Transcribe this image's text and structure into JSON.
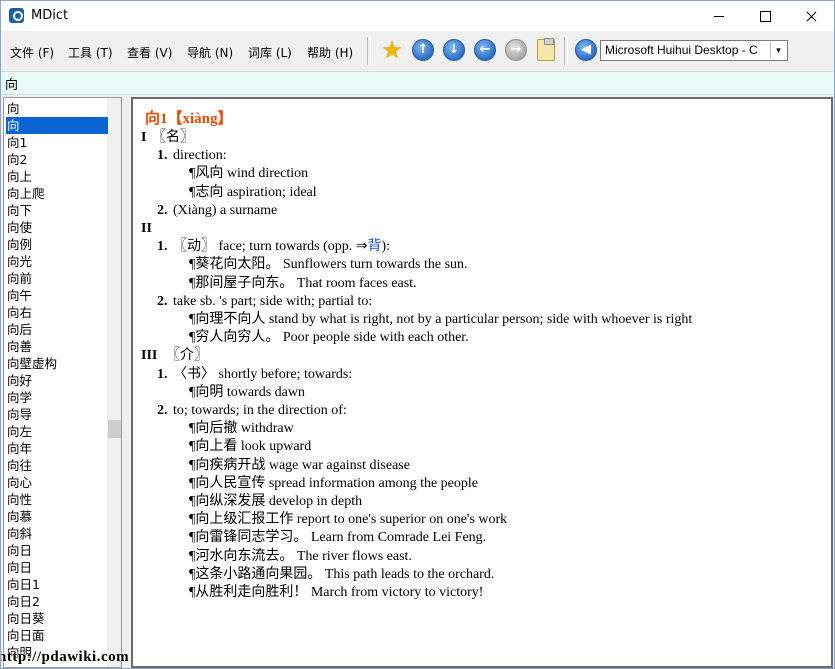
{
  "window": {
    "title": "MDict"
  },
  "menu": [
    "文件 (F)",
    "工具 (T)",
    "查看 (V)",
    "导航 (N)",
    "词库 (L)",
    "帮助 (H)"
  ],
  "toolbar": {
    "voice_select": "Microsoft Huihui Desktop - C",
    "dropdown_glyph": "▾",
    "icons": [
      "favorite-star-icon",
      "back-up-icon",
      "next-down-icon",
      "history-back-icon",
      "history-forward-icon",
      "clipboard-icon",
      "speak-icon"
    ]
  },
  "search": {
    "value": "向"
  },
  "word_list": {
    "selected_index": 1,
    "items": [
      "向",
      "向",
      "向1",
      "向2",
      "向上",
      "向上爬",
      "向下",
      "向使",
      "向例",
      "向光",
      "向前",
      "向午",
      "向右",
      "向后",
      "向善",
      "向壁虚构",
      "向好",
      "向学",
      "向导",
      "向左",
      "向年",
      "向往",
      "向心",
      "向性",
      "向慕",
      "向斜",
      "向日",
      "向日",
      "向日1",
      "向日2",
      "向日葵",
      "向日面",
      "向明"
    ]
  },
  "entry": {
    "headword": "向1【xiàng】",
    "lines": [
      {
        "label": "I",
        "text": "〖名〗"
      },
      {
        "label": "1.",
        "text": "direction:"
      },
      {
        "text": "¶风向 wind direction"
      },
      {
        "text": "¶志向 aspiration; ideal"
      },
      {
        "label": "2.",
        "text": "(Xiàng) a surname"
      },
      {
        "label": "II",
        "text": ""
      },
      {
        "label": "1.",
        "text": "〖动〗 face; turn towards (opp. ⇒",
        "link": "背",
        "after": "):"
      },
      {
        "text": "¶葵花向太阳。 Sunflowers turn towards the sun."
      },
      {
        "text": "¶那间屋子向东。 That room faces east."
      },
      {
        "label": "2.",
        "text": "take sb. 's part; side with; partial to:"
      },
      {
        "text": "¶向理不向人 stand by what is right, not by a particular person; side with whoever is right"
      },
      {
        "text": "¶穷人向穷人。 Poor people side with each other."
      },
      {
        "label": "III",
        "text": "〖介〗"
      },
      {
        "label": "1.",
        "text": "〈书〉 shortly before; towards:"
      },
      {
        "text": "¶向明 towards dawn"
      },
      {
        "label": "2.",
        "text": "to; towards; in the direction of:"
      },
      {
        "text": "¶向后撤 withdraw"
      },
      {
        "text": "¶向上看 look upward"
      },
      {
        "text": "¶向疾病开战 wage war against disease"
      },
      {
        "text": "¶向人民宣传 spread information among the people"
      },
      {
        "text": "¶向纵深发展 develop in depth"
      },
      {
        "text": "¶向上级汇报工作 report to one's superior on one's work"
      },
      {
        "text": "¶向雷锋同志学习。 Learn from Comrade Lei Feng."
      },
      {
        "text": "¶河水向东流去。 The river flows east."
      },
      {
        "text": "¶这条小路通向果园。 This path leads to the orchard."
      },
      {
        "text": "¶从胜利走向胜利！ March from victory to victory!"
      }
    ]
  },
  "watermark": "http://pdawiki.com"
}
